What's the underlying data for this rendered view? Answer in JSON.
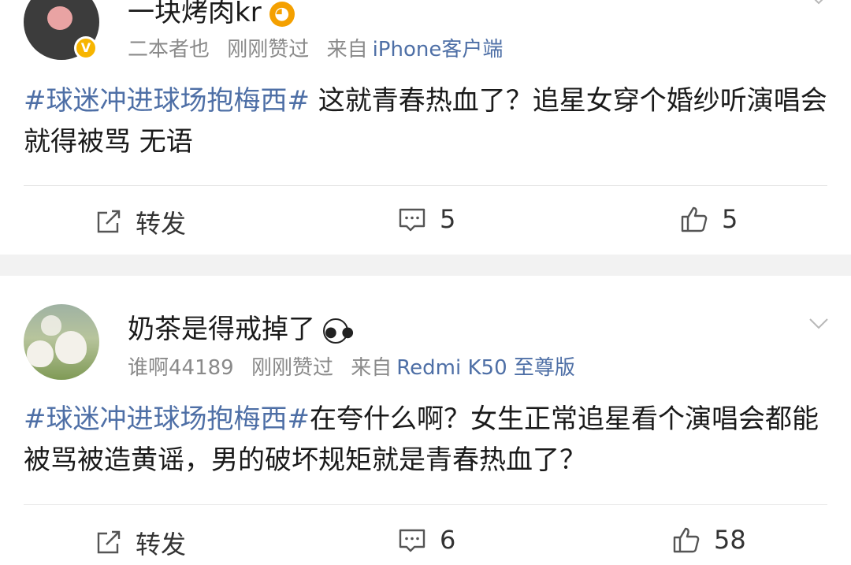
{
  "posts": [
    {
      "username": "一块烤肉kr",
      "badge": "V",
      "meta": {
        "handle": "二本者也",
        "time": "刚刚赞过",
        "from": "来自",
        "source": "iPhone客户端"
      },
      "content": {
        "tag": "#球迷冲进球场抱梅西#",
        "text": " 这就青春热血了？追星女穿个婚纱听演唱会就得被骂 无语"
      },
      "actions": {
        "repost": "转发",
        "comments": "5",
        "likes": "5"
      }
    },
    {
      "username": "奶茶是得戒掉了",
      "meta": {
        "handle": "谁啊44189",
        "time": "刚刚赞过",
        "from": "来自",
        "source": "Redmi K50 至尊版"
      },
      "content": {
        "tag": "#球迷冲进球场抱梅西#",
        "text": "在夸什么啊？女生正常追星看个演唱会都能被骂被造黄谣，男的破坏规矩就是青春热血了？"
      },
      "actions": {
        "repost": "转发",
        "comments": "6",
        "likes": "58"
      }
    }
  ],
  "colors": {
    "link": "#4e6fa6",
    "badge": "#f7b500",
    "separator": "#f2f2f2"
  }
}
